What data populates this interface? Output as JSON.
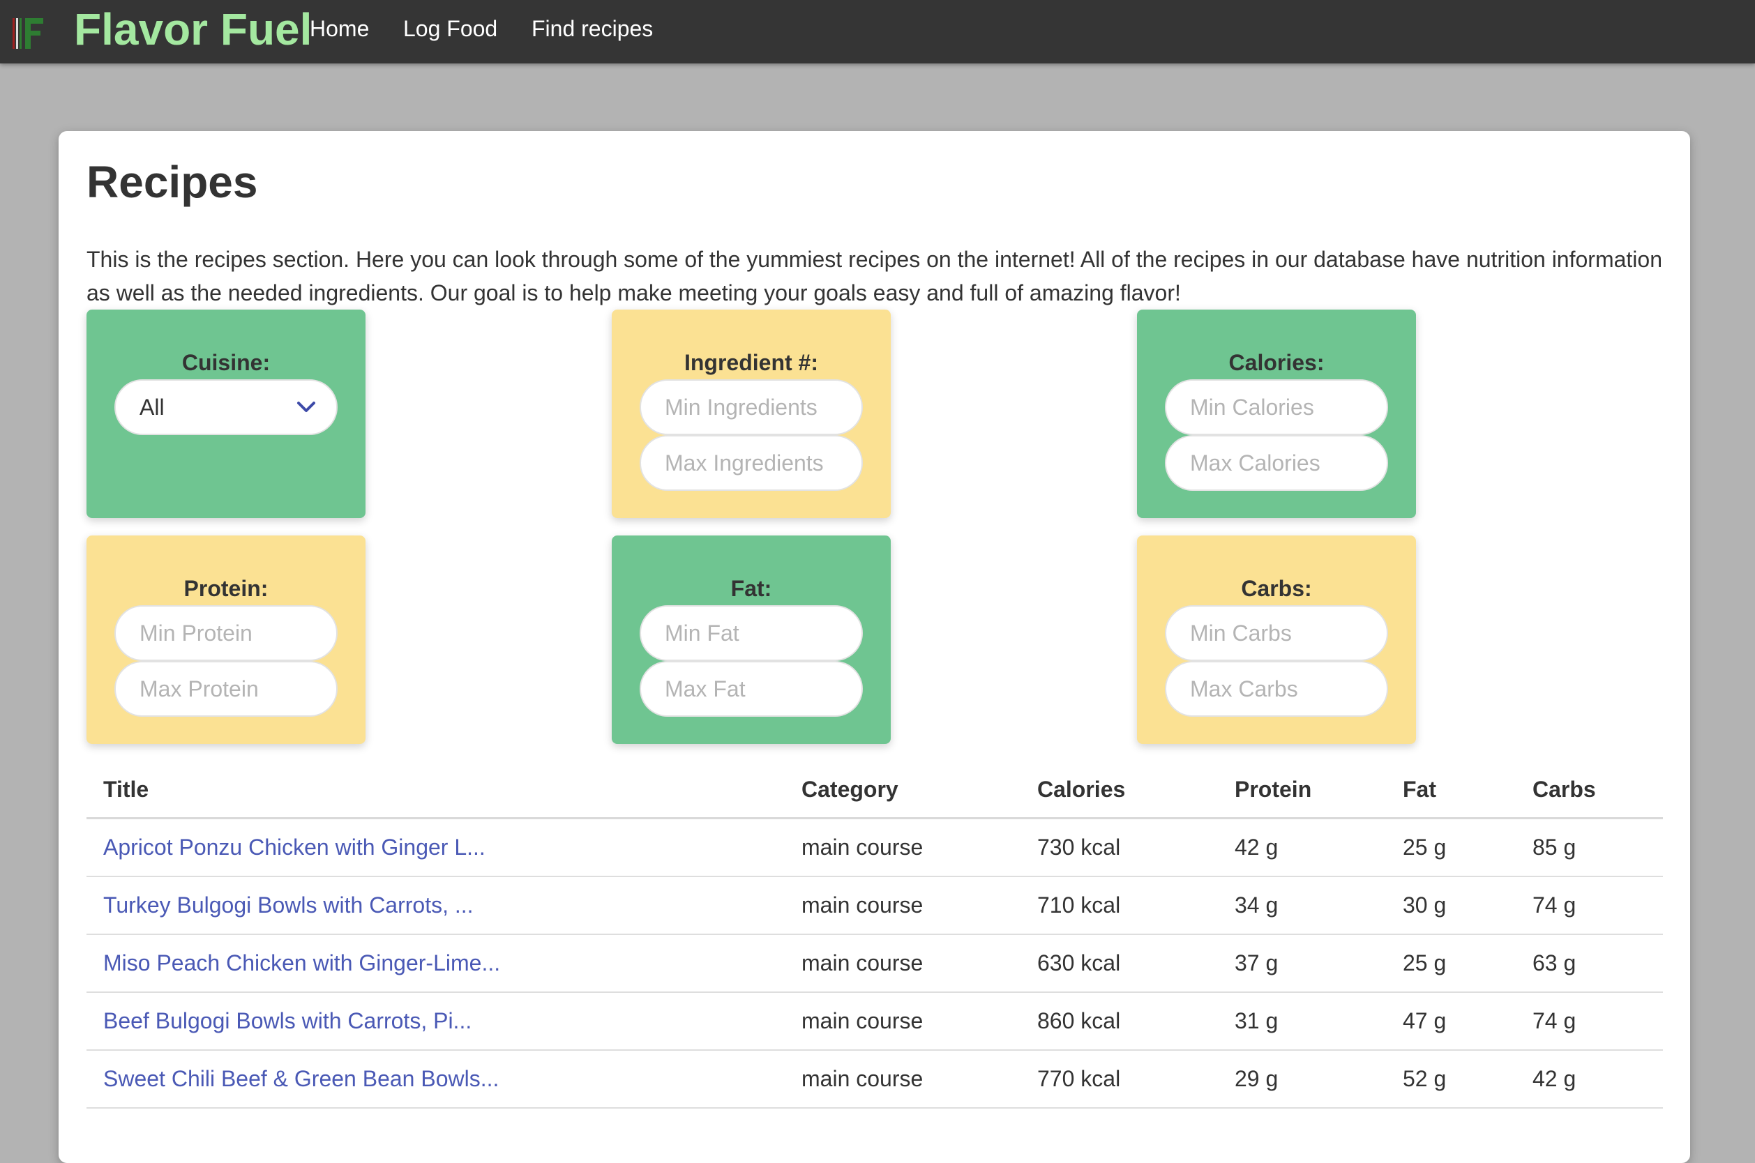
{
  "navbar": {
    "brand": "Flavor Fuel",
    "links": [
      "Home",
      "Log Food",
      "Find recipes"
    ]
  },
  "page": {
    "title": "Recipes",
    "intro": "This is the recipes section. Here you can look through some of the yummiest recipes on the internet! All of the recipes in our database have nutrition information as well as the needed ingredients. Our goal is to help make meeting your goals easy and full of amazing flavor!"
  },
  "filters": {
    "cuisine": {
      "label": "Cuisine:",
      "selected": "All"
    },
    "ingredients": {
      "label": "Ingredient #:",
      "min_placeholder": "Min Ingredients",
      "max_placeholder": "Max Ingredients"
    },
    "calories": {
      "label": "Calories:",
      "min_placeholder": "Min Calories",
      "max_placeholder": "Max Calories"
    },
    "protein": {
      "label": "Protein:",
      "min_placeholder": "Min Protein",
      "max_placeholder": "Max Protein"
    },
    "fat": {
      "label": "Fat:",
      "min_placeholder": "Min Fat",
      "max_placeholder": "Max Fat"
    },
    "carbs": {
      "label": "Carbs:",
      "min_placeholder": "Min Carbs",
      "max_placeholder": "Max Carbs"
    }
  },
  "table": {
    "headers": [
      "Title",
      "Category",
      "Calories",
      "Protein",
      "Fat",
      "Carbs"
    ],
    "rows": [
      {
        "title": "Apricot Ponzu Chicken with Ginger L...",
        "category": "main course",
        "calories": "730 kcal",
        "protein": "42 g",
        "fat": "25 g",
        "carbs": "85 g"
      },
      {
        "title": "Turkey Bulgogi Bowls with Carrots, ...",
        "category": "main course",
        "calories": "710 kcal",
        "protein": "34 g",
        "fat": "30 g",
        "carbs": "74 g"
      },
      {
        "title": "Miso Peach Chicken with Ginger-Lime...",
        "category": "main course",
        "calories": "630 kcal",
        "protein": "37 g",
        "fat": "25 g",
        "carbs": "63 g"
      },
      {
        "title": "Beef Bulgogi Bowls with Carrots, Pi...",
        "category": "main course",
        "calories": "860 kcal",
        "protein": "31 g",
        "fat": "47 g",
        "carbs": "74 g"
      },
      {
        "title": "Sweet Chili Beef & Green Bean Bowls...",
        "category": "main course",
        "calories": "770 kcal",
        "protein": "29 g",
        "fat": "52 g",
        "carbs": "42 g"
      }
    ]
  },
  "colors": {
    "navbar_bg": "#353535",
    "brand": "#a4e8a0",
    "filter_green": "#6fc591",
    "filter_yellow": "#fbe193",
    "link": "#4a59b5",
    "page_bg": "#b3b3b3"
  },
  "icons": {
    "logo": "flavor-fuel-logo-icon",
    "dropdown": "chevron-down-icon"
  }
}
